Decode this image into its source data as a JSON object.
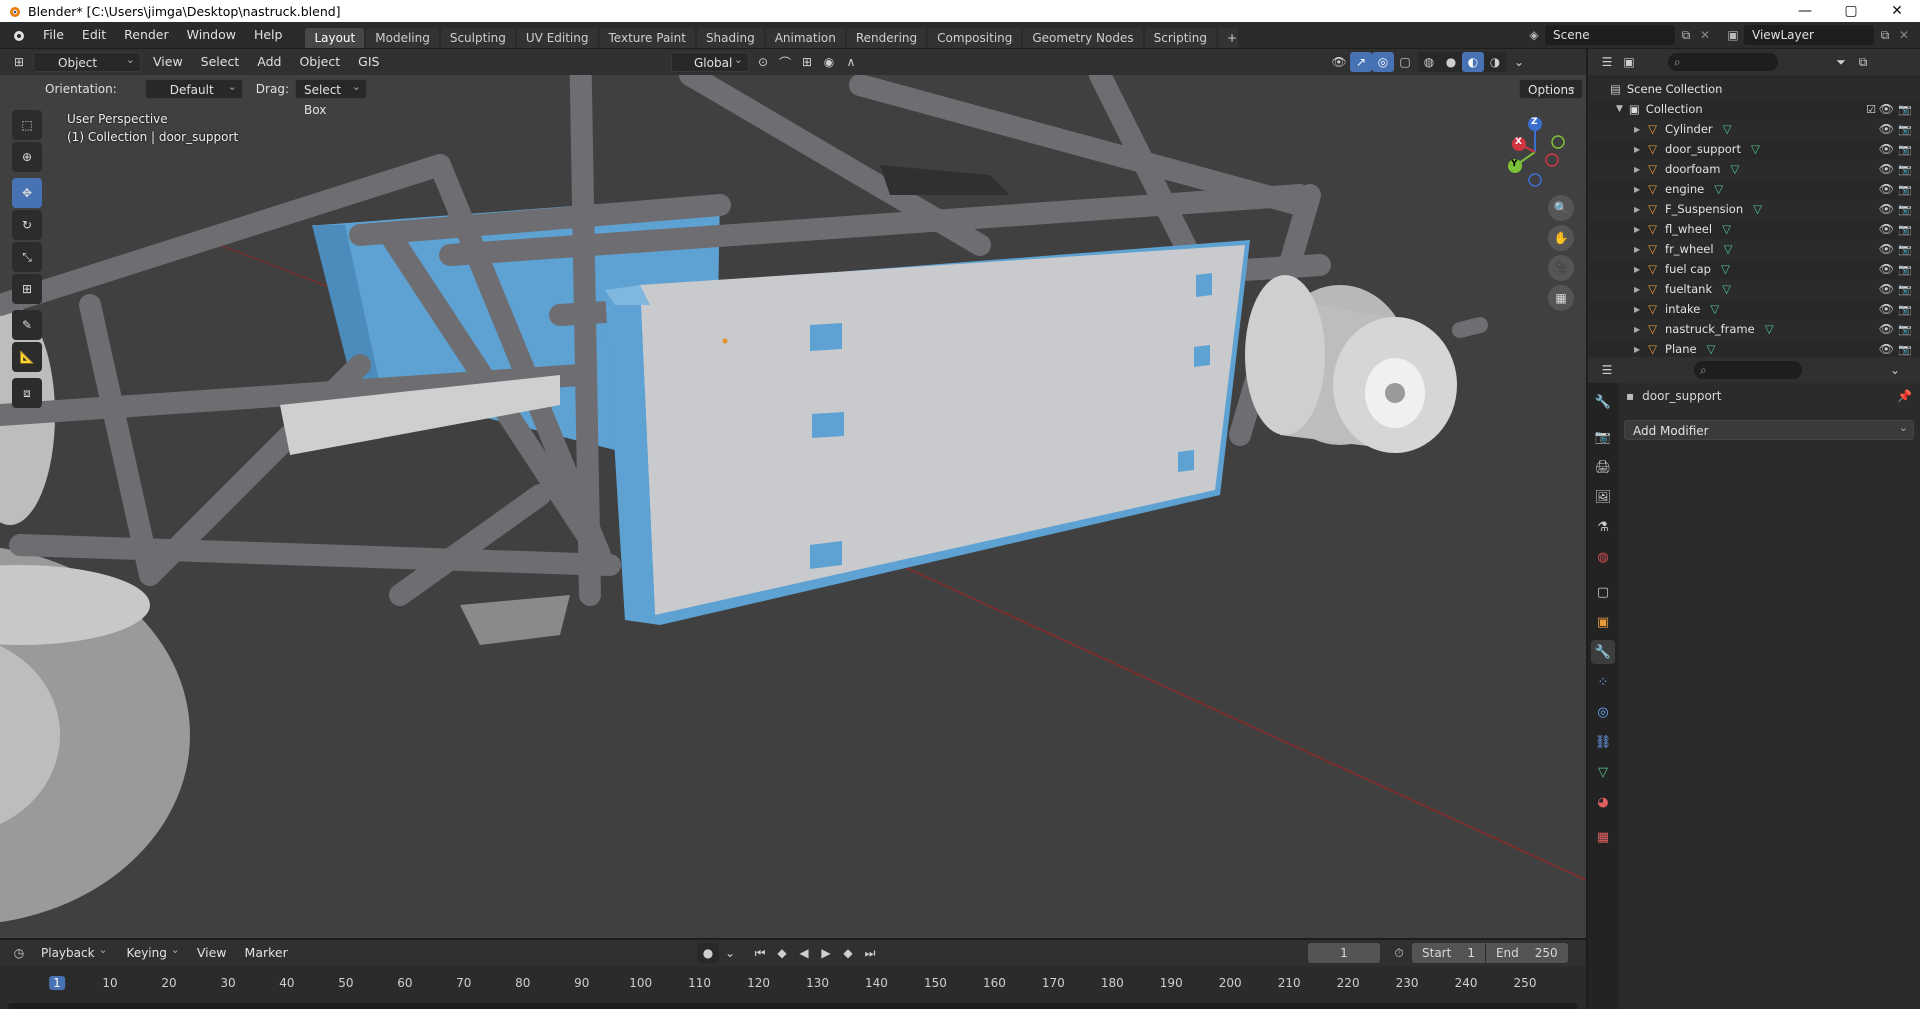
{
  "window": {
    "title": "Blender* [C:\\Users\\jimga\\Desktop\\nastruck.blend]"
  },
  "topbar": {
    "menus": [
      "File",
      "Edit",
      "Render",
      "Window",
      "Help"
    ],
    "workspaces": [
      "Layout",
      "Modeling",
      "Sculpting",
      "UV Editing",
      "Texture Paint",
      "Shading",
      "Animation",
      "Rendering",
      "Compositing",
      "Geometry Nodes",
      "Scripting"
    ],
    "active_workspace": "Layout",
    "scene": "Scene",
    "view_layer": "ViewLayer"
  },
  "viewport_header": {
    "mode": "Object Mode",
    "menus": [
      "View",
      "Select",
      "Add",
      "Object",
      "GIS"
    ],
    "transform": "Global"
  },
  "tool_settings": {
    "orientation_label": "Orientation:",
    "orientation_value": "Default",
    "drag_label": "Drag:",
    "drag_value": "Select Box",
    "options": "Options"
  },
  "viewport": {
    "perspective": "User Perspective",
    "collection_info": "(1) Collection | door_support",
    "gizmo": {
      "z": "Z",
      "y": "Y",
      "x": "X"
    }
  },
  "outliner": {
    "root": "Scene Collection",
    "collection": "Collection",
    "objects": [
      "Cylinder",
      "door_support",
      "doorfoam",
      "engine",
      "F_Suspension",
      "fl_wheel",
      "fr_wheel",
      "fuel cap",
      "fueltank",
      "intake",
      "nastruck_frame",
      "Plane"
    ]
  },
  "properties": {
    "object_name": "door_support",
    "add_modifier": "Add Modifier"
  },
  "timeline": {
    "menus": [
      "Playback",
      "Keying",
      "View",
      "Marker"
    ],
    "current_frame": "1",
    "start_label": "Start",
    "start": "1",
    "end_label": "End",
    "end": "250",
    "ticks": [
      "1",
      "10",
      "20",
      "30",
      "40",
      "50",
      "60",
      "70",
      "80",
      "90",
      "100",
      "110",
      "120",
      "130",
      "140",
      "150",
      "160",
      "170",
      "180",
      "190",
      "200",
      "210",
      "220",
      "230",
      "240",
      "250"
    ]
  },
  "colors": {
    "accent": "#4772b3",
    "selection_outline": "#5ea3d6",
    "object_icon": "#e89a3c",
    "mesh_icon": "#4fc18f"
  }
}
